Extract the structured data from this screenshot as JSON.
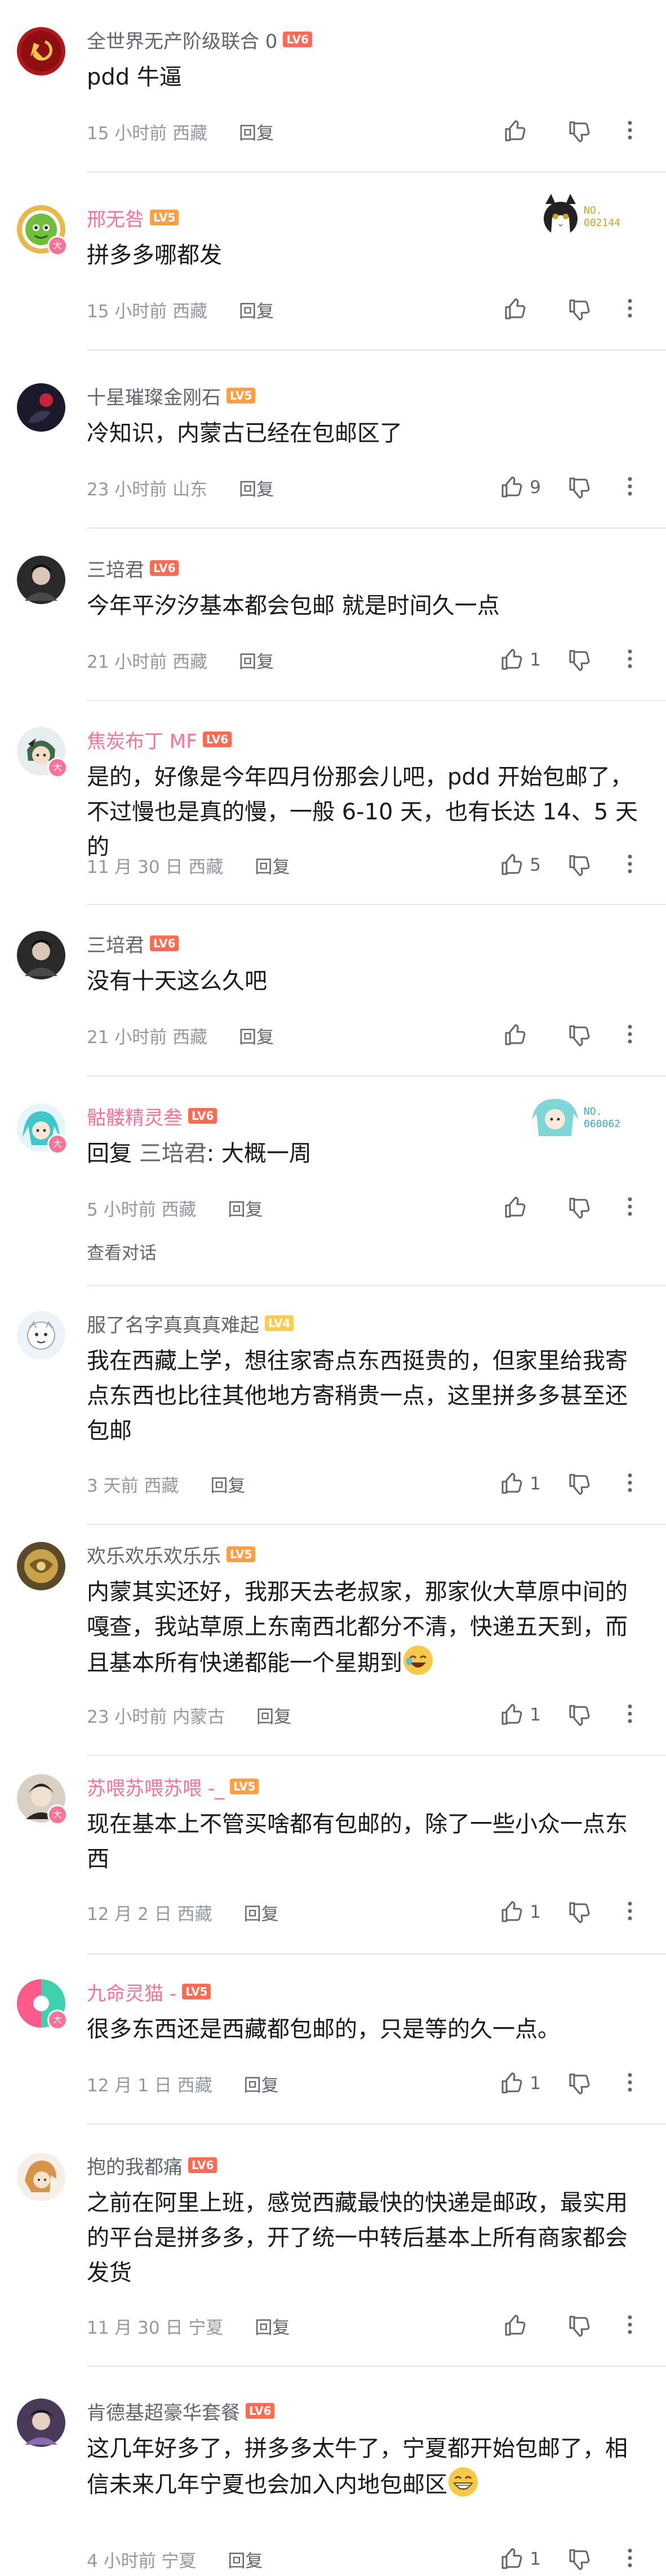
{
  "reply_label": "回复",
  "view_conversation": "查看对话",
  "comments": [
    {
      "user": "全世界无产阶级联合 0",
      "level": "LV6",
      "text": "pdd 牛逼",
      "time": "15 小时前",
      "location": "西藏",
      "likes": ""
    },
    {
      "user": "邢无咎",
      "level": "LV5",
      "text": "拼多多哪都发",
      "time": "15 小时前",
      "location": "西藏",
      "likes": "",
      "badge_no": "NO.\n002144"
    },
    {
      "user": "十星璀璨金刚石",
      "level": "LV5",
      "text": "冷知识，内蒙古已经在包邮区了",
      "time": "23 小时前",
      "location": "山东",
      "likes": "9"
    },
    {
      "user": "三培君",
      "level": "LV6",
      "text": "今年平汐汐基本都会包邮 就是时间久一点",
      "time": "21 小时前",
      "location": "西藏",
      "likes": "1"
    },
    {
      "user": "焦炭布丁 MF",
      "level": "LV6",
      "text": "是的，好像是今年四月份那会儿吧，pdd 开始包邮了，不过慢也是真的慢，一般 6-10 天，也有长达 14、5 天的",
      "time": "11 月 30 日",
      "location": "西藏",
      "likes": "5"
    },
    {
      "user": "三培君",
      "level": "LV6",
      "text": "没有十天这么久吧",
      "time": "21 小时前",
      "location": "西藏",
      "likes": ""
    },
    {
      "user": "骷髅精灵叁",
      "level": "LV6",
      "reply_prefix": "回复 ",
      "reply_target": "三培君",
      "text": ": 大概一周",
      "time": "5 小时前",
      "location": "西藏",
      "likes": "",
      "badge_no": "NO.\n060062"
    },
    {
      "user": "服了名字真真真难起",
      "level": "LV4",
      "text": "我在西藏上学，想往家寄点东西挺贵的，但家里给我寄点东西也比往其他地方寄稍贵一点，这里拼多多甚至还包邮",
      "time": "3 天前",
      "location": "西藏",
      "likes": "1"
    },
    {
      "user": "欢乐欢乐欢乐乐",
      "level": "LV5",
      "text": "内蒙其实还好，我那天去老叔家，那家伙大草原中间的嘎查，我站草原上东南西北都分不清，快递五天到，而且基本所有快递都能一个星期到",
      "time": "23 小时前",
      "location": "内蒙古",
      "likes": "1"
    },
    {
      "user": "苏喂苏喂苏喂 -_",
      "level": "LV5",
      "text": "现在基本上不管买啥都有包邮的，除了一些小众一点东西",
      "time": "12 月 2 日",
      "location": "西藏",
      "likes": "1"
    },
    {
      "user": "九命灵猫 -",
      "level": "LV5",
      "text": "很多东西还是西藏都包邮的，只是等的久一点。",
      "time": "12 月 1 日",
      "location": "西藏",
      "likes": "1"
    },
    {
      "user": "抱的我都痛",
      "level": "LV6",
      "text": "之前在阿里上班，感觉西藏最快的快递是邮政，最实用的平台是拼多多，开了统一中转后基本上所有商家都会发货",
      "time": "11 月 30 日",
      "location": "宁夏",
      "likes": ""
    },
    {
      "user": "肯德基超豪华套餐",
      "level": "LV6",
      "text": "这几年好多了，拼多多太牛了，宁夏都开始包邮了，相信未来几年宁夏也会加入内地包邮区",
      "time": "4 小时前",
      "location": "宁夏",
      "likes": "1"
    }
  ],
  "colors": {
    "accent_pink": "#fb7299",
    "level_red": "#ff6a52",
    "meta_gray": "#9499a0"
  }
}
